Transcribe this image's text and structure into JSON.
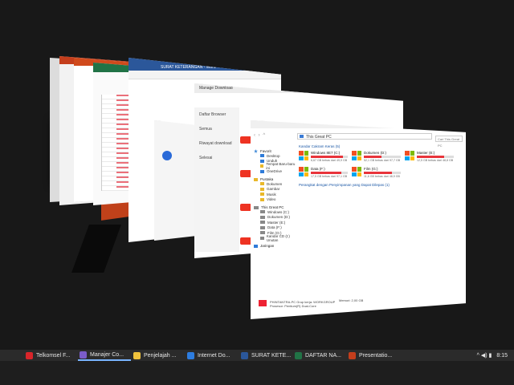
{
  "explorer": {
    "address": "This Great PC",
    "search_placeholder": "Cari This Great PC",
    "nav": "‹ › ^",
    "sidebar": {
      "favorites_label": "Favorit",
      "favorites": [
        "Desktop",
        "Unduh",
        "Tempat Baru-baru ini",
        "OneDrive"
      ],
      "libraries_label": "Pustaka",
      "libraries": [
        "Dokumen",
        "Gambar",
        "Musik",
        "Video"
      ],
      "pc_label": "This Great PC",
      "drives": [
        "Windows (C:)",
        "Dokumen (D:)",
        "Master (E:)",
        "Data (F:)",
        "Film (G:)",
        "Kandar CD (I:) Unutan"
      ],
      "network_label": "Jaringan"
    },
    "section_drives": "Kandar Cakram Keras (5)",
    "section_removable": "Perangkat dengan Penyimpanan yang Dapat Dilepas (1)",
    "drive_list": [
      {
        "name": "Windows 8E7 (C:)",
        "free": "6,67 GB bebas dari 49,9 GB",
        "fill": 0.87
      },
      {
        "name": "Dokumen (D:)",
        "free": "52,1 GB bebas dari 97,7 GB",
        "fill": 0.47
      },
      {
        "name": "Master (E:)",
        "free": "12,5 GB bebas dari 48,8 GB",
        "fill": 0.74
      },
      {
        "name": "Data (F:)",
        "free": "17,5 GB bebas dari 97,1 GB",
        "fill": 0.82
      },
      {
        "name": "Film (G:)",
        "free": "11,6 GB bebas dari 48,9 GB",
        "fill": 0.76
      }
    ],
    "status_name": "PHINTANTRA-PC",
    "status_line1": "PHINTANTRA-PC  Grup kerja: WORKGROUP",
    "status_line2": "Prosesor: Pentium(R) Dual-Core",
    "version_label": "Memori: 2,00 GB"
  },
  "browser_window": {
    "title": "Manage Download",
    "sidebar": [
      "Daftar Browser",
      "Semua",
      "Riwayat download",
      "Selesai"
    ]
  },
  "word_window": {
    "title": "SURAT KETERANGAN - Word"
  },
  "downloader_window": {
    "add_label": "Add URL",
    "categories_label": "Categories"
  },
  "taskbar": {
    "items": [
      {
        "label": "Telkomsel F...",
        "color": "#d9252a",
        "active": false
      },
      {
        "label": "Manajer Co...",
        "color": "#7a5cc9",
        "active": true
      },
      {
        "label": "Penjelajah ...",
        "color": "#f0c23c",
        "active": false
      },
      {
        "label": "Internet Do...",
        "color": "#2d7de0",
        "active": false
      },
      {
        "label": "SURAT KETE...",
        "color": "#2b579a",
        "active": false
      },
      {
        "label": "DAFTAR NA...",
        "color": "#217346",
        "active": false
      },
      {
        "label": "Presentatio...",
        "color": "#c43e1c",
        "active": false
      }
    ],
    "clock": "8:15",
    "tray_icons": "^ ◀) ▮"
  }
}
